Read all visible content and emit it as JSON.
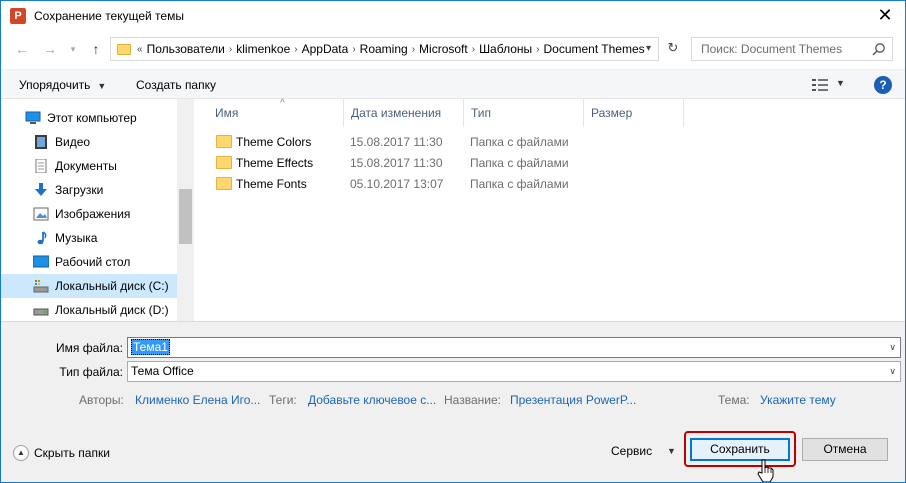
{
  "window": {
    "title": "Сохранение текущей темы",
    "app_icon_letter": "P"
  },
  "nav": {
    "breadcrumb_prefix": "«",
    "breadcrumbs": [
      "Пользователи",
      "klimenkoe",
      "AppData",
      "Roaming",
      "Microsoft",
      "Шаблоны",
      "Document Themes"
    ],
    "search_placeholder": "Поиск: Document Themes"
  },
  "toolbar": {
    "organize_label": "Упорядочить",
    "new_folder_label": "Создать папку",
    "help_label": "?"
  },
  "sidebar": {
    "items": [
      {
        "label": "Этот компьютер",
        "icon": "computer-icon"
      },
      {
        "label": "Видео",
        "icon": "video-icon"
      },
      {
        "label": "Документы",
        "icon": "documents-icon"
      },
      {
        "label": "Загрузки",
        "icon": "downloads-icon"
      },
      {
        "label": "Изображения",
        "icon": "pictures-icon"
      },
      {
        "label": "Музыка",
        "icon": "music-icon"
      },
      {
        "label": "Рабочий стол",
        "icon": "desktop-icon"
      },
      {
        "label": "Локальный диск (C:)",
        "icon": "drive-icon",
        "selected": true
      },
      {
        "label": "Локальный диск (D:)",
        "icon": "drive-icon"
      }
    ]
  },
  "filelist": {
    "columns": [
      "Имя",
      "Дата изменения",
      "Тип",
      "Размер"
    ],
    "rows": [
      {
        "name": "Theme Colors",
        "date": "15.08.2017 11:30",
        "type": "Папка с файлами"
      },
      {
        "name": "Theme Effects",
        "date": "15.08.2017 11:30",
        "type": "Папка с файлами"
      },
      {
        "name": "Theme Fonts",
        "date": "05.10.2017 13:07",
        "type": "Папка с файлами"
      }
    ]
  },
  "form": {
    "filename_label": "Имя файла:",
    "filename_value": "Тема1",
    "filetype_label": "Тип файла:",
    "filetype_value": "Тема Office",
    "authors_label": "Авторы:",
    "authors_value": "Клименко Елена Иго...",
    "tags_label": "Теги:",
    "tags_value": "Добавьте ключевое с...",
    "title_label": "Название:",
    "title_value": "Презентация PowerP...",
    "theme_label": "Тема:",
    "theme_value": "Укажите тему"
  },
  "footer": {
    "hide_folders_label": "Скрыть папки",
    "service_label": "Сервис",
    "save_label": "Сохранить",
    "cancel_label": "Отмена"
  },
  "colors": {
    "accent": "#0078d7",
    "highlight_border": "#c00000",
    "link": "#1a66b5",
    "selection": "#cce8ff"
  }
}
